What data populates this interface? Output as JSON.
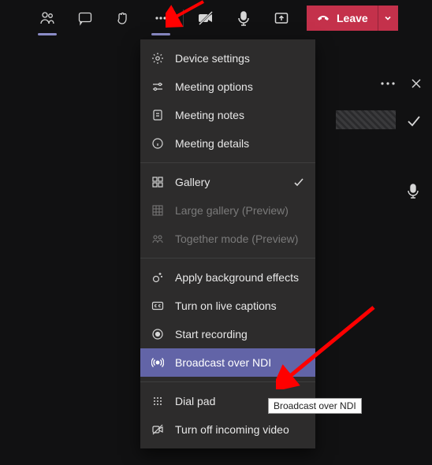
{
  "topbar": {
    "leave_label": "Leave"
  },
  "menu": {
    "device_settings": "Device settings",
    "meeting_options": "Meeting options",
    "meeting_notes": "Meeting notes",
    "meeting_details": "Meeting details",
    "gallery": "Gallery",
    "large_gallery": "Large gallery (Preview)",
    "together_mode": "Together mode (Preview)",
    "apply_bg": "Apply background effects",
    "live_captions": "Turn on live captions",
    "start_recording": "Start recording",
    "broadcast_ndi": "Broadcast over NDI",
    "dial_pad": "Dial pad",
    "turn_off_video": "Turn off incoming video"
  },
  "tooltip": {
    "ndi": "Broadcast over NDI"
  }
}
